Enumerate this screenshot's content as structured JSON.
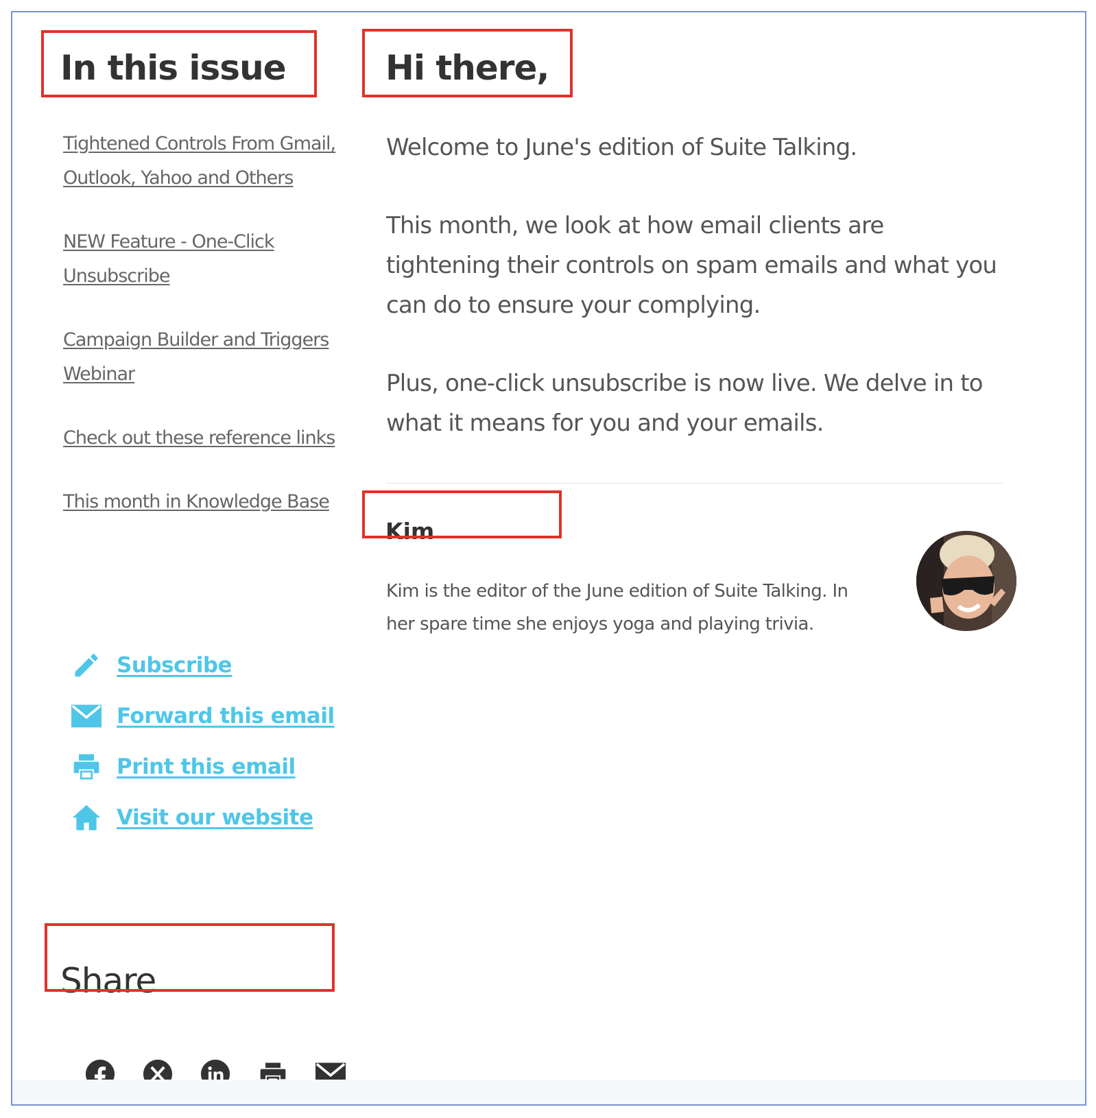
{
  "sidebar": {
    "heading": "In this issue",
    "toc": [
      {
        "label": "Tightened Controls From Gmail, Outlook, Yahoo and Others"
      },
      {
        "label": "NEW Feature - One-Click Unsubscribe"
      },
      {
        "label": "Campaign Builder and Triggers Webinar"
      },
      {
        "label": "Check out these reference links"
      },
      {
        "label": "This month in Knowledge Base"
      }
    ],
    "actions": [
      {
        "label": "Subscribe",
        "icon": "pencil-icon"
      },
      {
        "label": "Forward this email",
        "icon": "envelope-icon"
      },
      {
        "label": "Print this email",
        "icon": "printer-icon"
      },
      {
        "label": "Visit our website",
        "icon": "home-icon"
      }
    ],
    "share": {
      "heading": "Share",
      "icons": [
        "facebook-icon",
        "x-icon",
        "linkedin-icon",
        "printer-icon",
        "envelope-icon"
      ]
    }
  },
  "main": {
    "greeting": "Hi there,",
    "paragraphs": [
      "Welcome to June's edition of Suite Talking.",
      "This month, we look at how email clients are tightening their controls on spam emails and what you can do to ensure your complying.",
      "Plus, one-click unsubscribe is now live. We delve in to what it means for you and your emails."
    ],
    "editor": {
      "name": "Kim",
      "bio": "Kim is the editor of the June edition of Suite Talking. In her spare time she enjoys yoga and playing trivia."
    }
  },
  "colors": {
    "highlight": "#e03229",
    "accent": "#4fc6e8",
    "frame_border": "#7a93c9",
    "heading_text": "#333333",
    "body_text": "#555555"
  }
}
